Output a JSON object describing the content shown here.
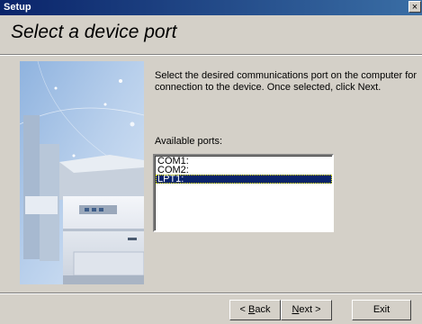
{
  "window": {
    "title": "Setup",
    "close_glyph": "×"
  },
  "header": {
    "heading": "Select a device port"
  },
  "main": {
    "description": "Select the desired communications port on the computer for connection to the device. Once selected, click Next.",
    "ports_label": "Available ports:",
    "ports": [
      "COM1:",
      "COM2:",
      "LPT1:"
    ],
    "selected_port": "LPT1:"
  },
  "buttons": {
    "back_prefix": "< ",
    "back_key": "B",
    "back_rest": "ack",
    "next_key": "N",
    "next_rest": "ext >",
    "exit": "Exit"
  },
  "colors": {
    "title_bar": "#0a246a",
    "selection": "#0a246a",
    "dialog_bg": "#d4d0c8"
  },
  "icons": {
    "close": "close-icon",
    "artwork": "printer-illustration"
  }
}
